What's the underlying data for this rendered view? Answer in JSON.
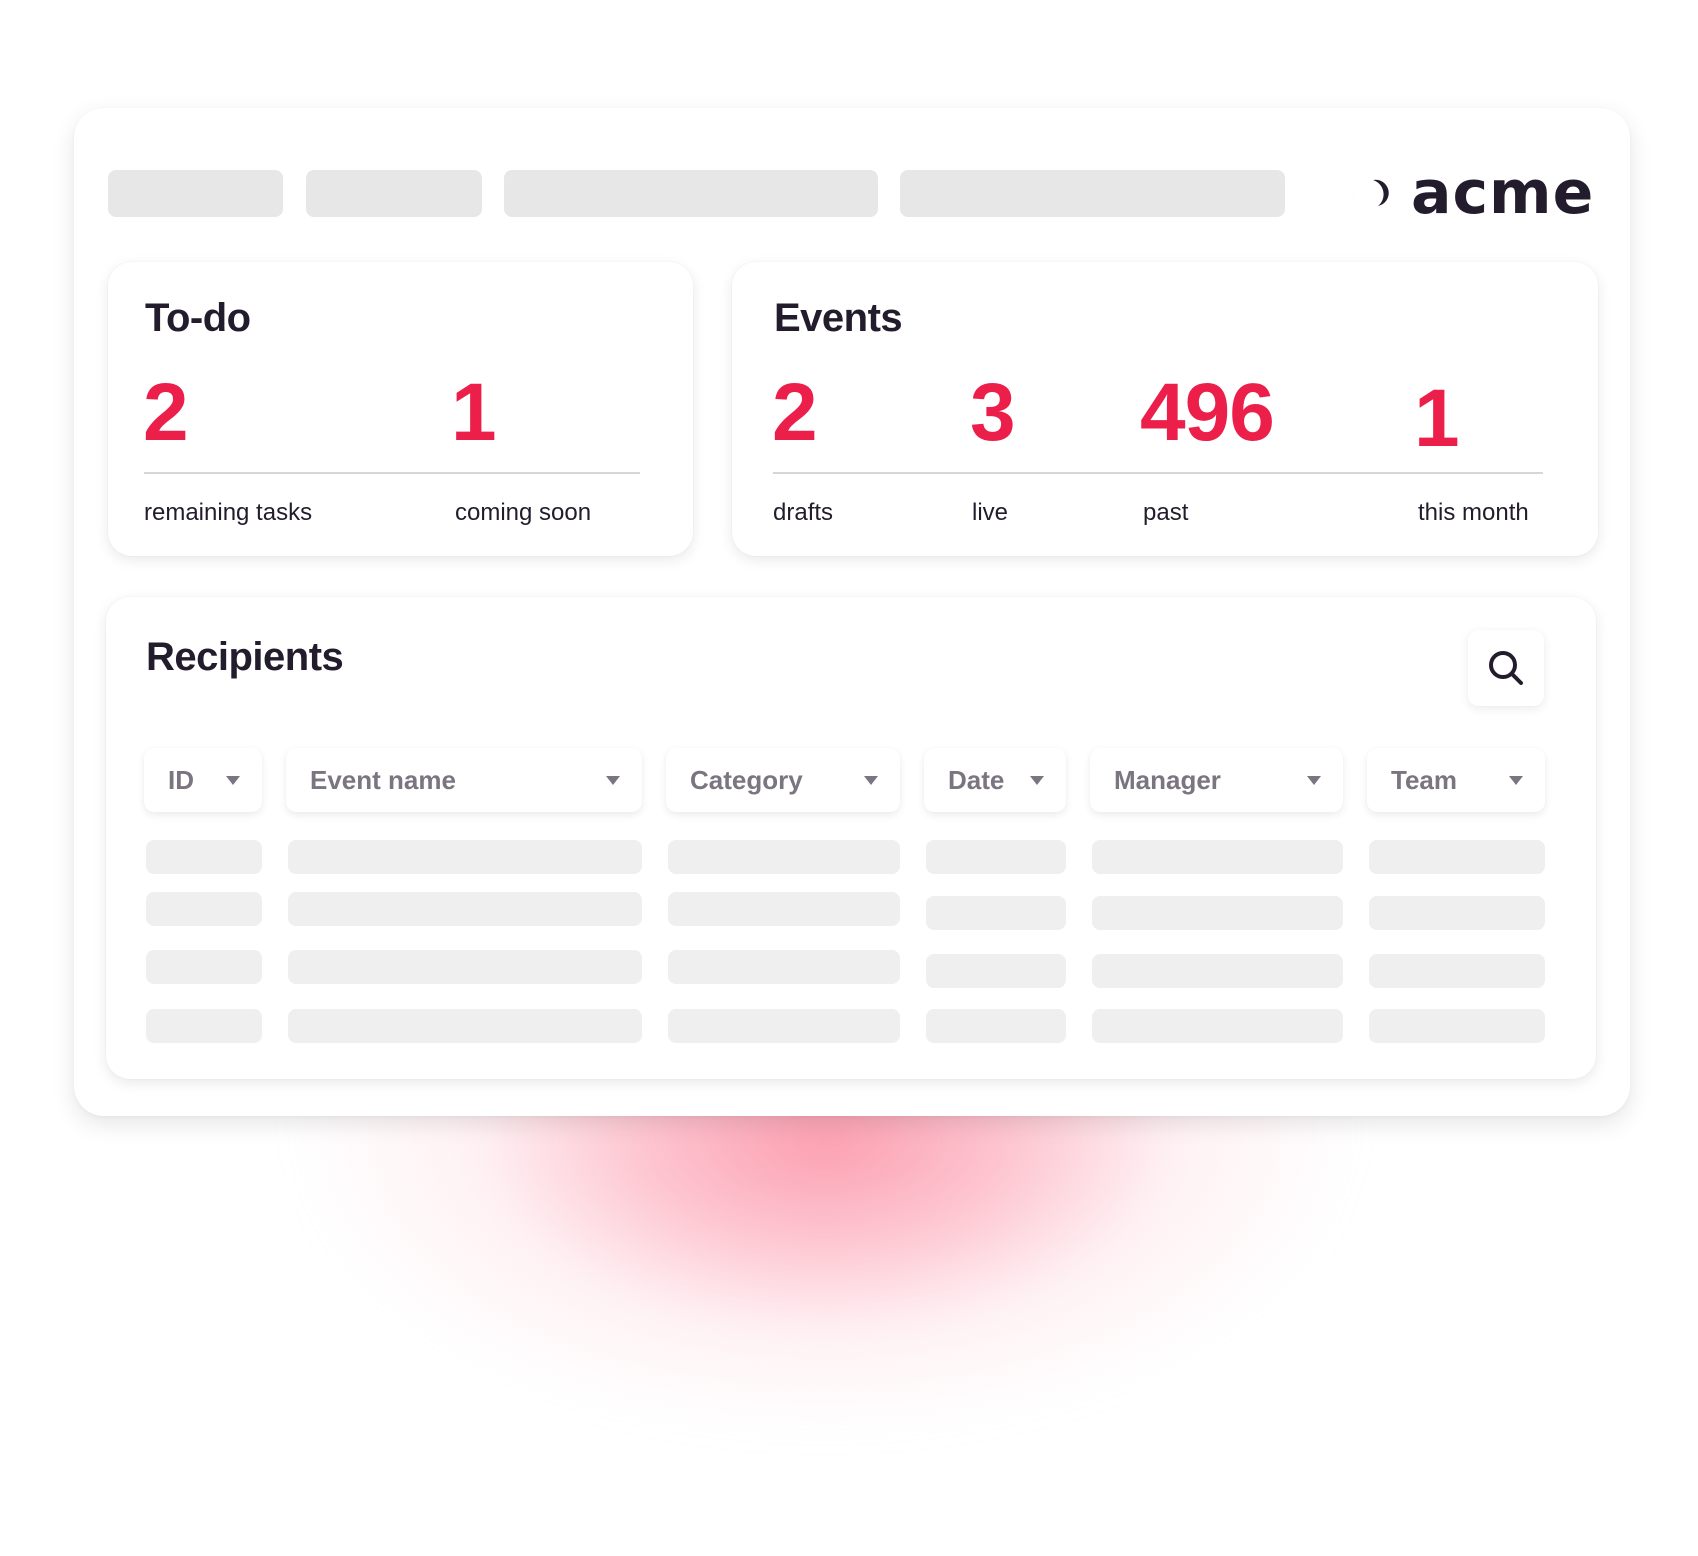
{
  "brand": {
    "name": "acme",
    "logo_icon": "crescent-ring-icon"
  },
  "colors": {
    "accent": "#ec1f4b",
    "text": "#231c2c",
    "muted": "#7a7580",
    "placeholder": "#e8e7e8",
    "skeleton": "#efefef"
  },
  "nav_placeholders": 4,
  "todo": {
    "title": "To-do",
    "stats": [
      {
        "value": "2",
        "label": "remaining tasks"
      },
      {
        "value": "1",
        "label": "coming soon"
      }
    ]
  },
  "events": {
    "title": "Events",
    "stats": [
      {
        "value": "2",
        "label": "drafts"
      },
      {
        "value": "3",
        "label": "live"
      },
      {
        "value": "496",
        "label": "past"
      },
      {
        "value": "1",
        "label": "this month"
      }
    ]
  },
  "recipients": {
    "title": "Recipients",
    "search_icon": "search-icon",
    "columns": [
      {
        "label": "ID"
      },
      {
        "label": "Event name"
      },
      {
        "label": "Category"
      },
      {
        "label": "Date"
      },
      {
        "label": "Manager"
      },
      {
        "label": "Team"
      }
    ],
    "skeleton_rows": 4
  }
}
